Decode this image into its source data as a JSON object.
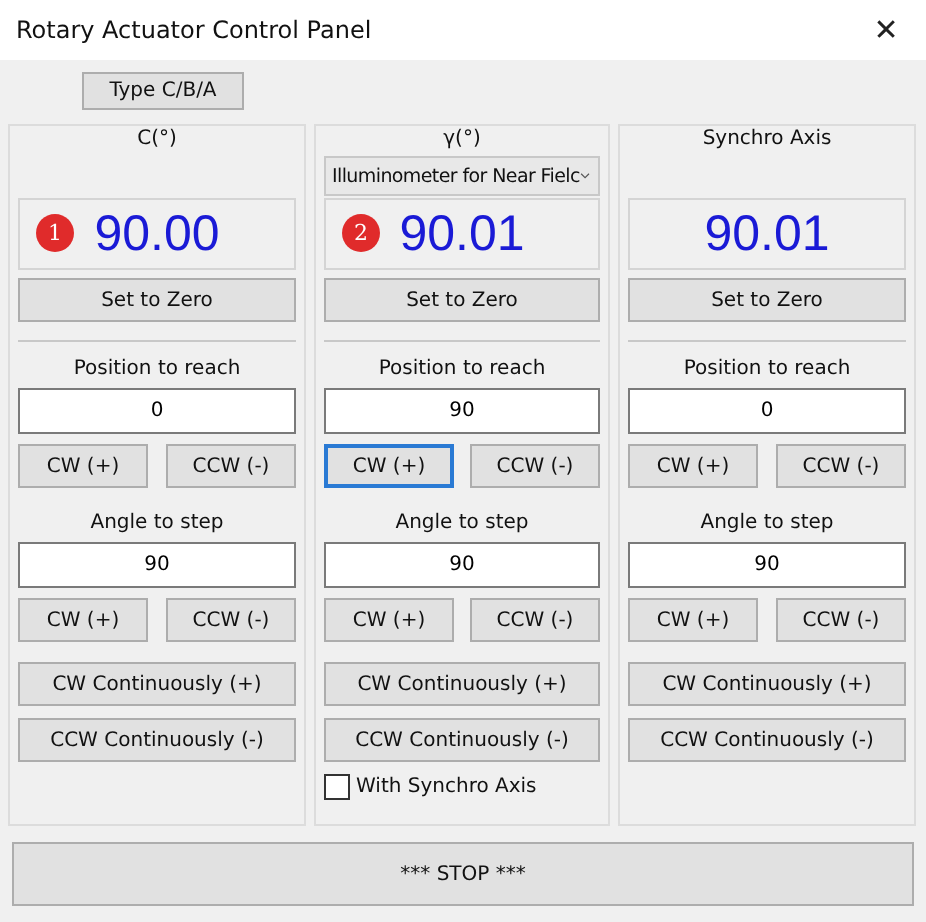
{
  "window": {
    "title": "Rotary Actuator Control Panel",
    "close": "✕"
  },
  "type_button": "Type C/B/A",
  "panels": [
    {
      "header": "C(°)",
      "badge": "1",
      "reading": "90.00",
      "zero": "Set to Zero",
      "position_label": "Position to reach",
      "position_value": "0",
      "position_cw": {
        "label": "CW  (+)",
        "focused": false
      },
      "position_ccw": "CCW (-)",
      "step_label": "Angle to step",
      "step_value": "90",
      "step_cw": "CW  (+)",
      "step_ccw": "CCW (-)",
      "cont_cw": "CW Continuously (+)",
      "cont_ccw": "CCW Continuously (-)"
    },
    {
      "header": "γ(°)",
      "dropdown": "Illuminometer for Near Fielc",
      "badge": "2",
      "reading": "90.01",
      "zero": "Set to Zero",
      "position_label": "Position to reach",
      "position_value": "90",
      "position_cw": {
        "label": "CW  (+)",
        "focused": true
      },
      "position_ccw": "CCW (-)",
      "step_label": "Angle to step",
      "step_value": "90",
      "step_cw": "CW  (+)",
      "step_ccw": "CCW (-)",
      "cont_cw": "CW Continuously (+)",
      "cont_ccw": "CCW Continuously (-)",
      "checkbox": {
        "label": "With Synchro Axis",
        "checked": false
      }
    },
    {
      "header": "Synchro Axis",
      "reading": "90.01",
      "zero": "Set to Zero",
      "position_label": "Position to reach",
      "position_value": "0",
      "position_cw": {
        "label": "CW  (+)",
        "focused": false
      },
      "position_ccw": "CCW (-)",
      "step_label": "Angle to step",
      "step_value": "90",
      "step_cw": "CW  (+)",
      "step_ccw": "CCW (-)",
      "cont_cw": "CW Continuously (+)",
      "cont_ccw": "CCW Continuously (-)"
    }
  ],
  "stop_button": "*** STOP ***"
}
